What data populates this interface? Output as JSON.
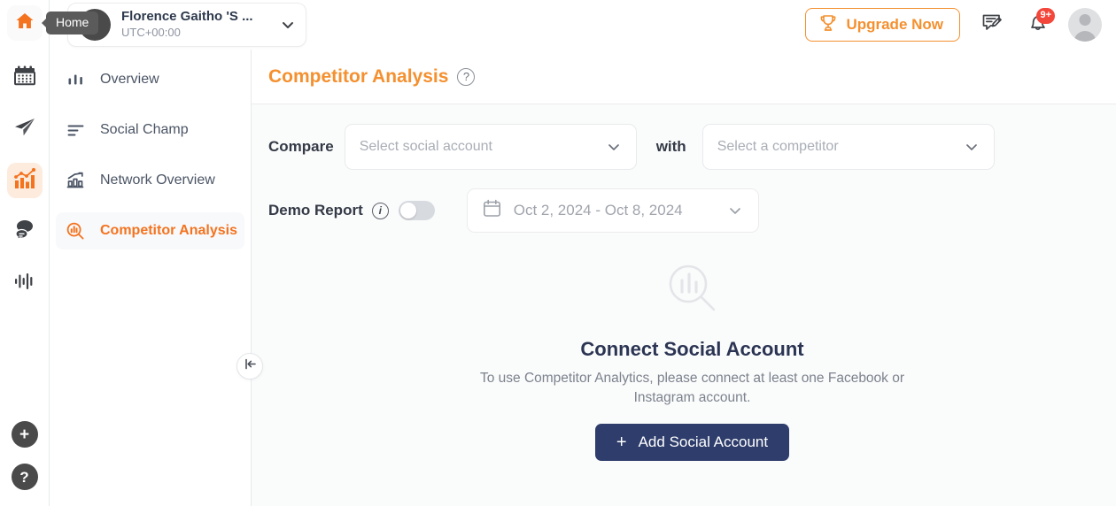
{
  "colors": {
    "brand_orange": "#f4902f",
    "active_orange": "#f4731f",
    "navy": "#2e3d6b",
    "badge_red": "#f4473b"
  },
  "rail": {
    "items": [
      {
        "name": "home-icon",
        "label": "Home"
      },
      {
        "name": "calendar-icon",
        "label": "Calendar"
      },
      {
        "name": "send-icon",
        "label": "Publish"
      },
      {
        "name": "analytics-icon",
        "label": "Analytics"
      },
      {
        "name": "messages-icon",
        "label": "Inbox"
      },
      {
        "name": "monitoring-icon",
        "label": "Monitoring"
      }
    ],
    "add_label": "+",
    "help_label": "?"
  },
  "tooltip": {
    "text": "Home"
  },
  "workspace": {
    "initial": "F",
    "name": "Florence Gaitho 'S ...",
    "timezone": "UTC+00:00"
  },
  "topbar": {
    "upgrade_label": "Upgrade Now",
    "notifications_badge": "9+"
  },
  "sidebar": {
    "items": [
      {
        "label": "Overview",
        "icon": "bar-chart-icon",
        "active": false
      },
      {
        "label": "Social Champ",
        "icon": "list-lines-icon",
        "active": false
      },
      {
        "label": "Network Overview",
        "icon": "trend-bars-icon",
        "active": false
      },
      {
        "label": "Competitor Analysis",
        "icon": "chart-search-icon",
        "active": true
      }
    ],
    "collapse_label": "Collapse sidebar"
  },
  "page": {
    "title": "Competitor Analysis",
    "help_label": "?"
  },
  "filters": {
    "compare_label": "Compare",
    "account_placeholder": "Select social account",
    "with_label": "with",
    "competitor_placeholder": "Select a competitor",
    "demo_report_label": "Demo Report",
    "demo_report_info": "i",
    "demo_report_on": false,
    "date_range": "Oct 2, 2024 - Oct 8, 2024"
  },
  "empty_state": {
    "title": "Connect Social Account",
    "description": "To use Competitor Analytics, please connect at least one Facebook or Instagram account.",
    "button_label": "Add Social Account",
    "button_plus": "+"
  }
}
